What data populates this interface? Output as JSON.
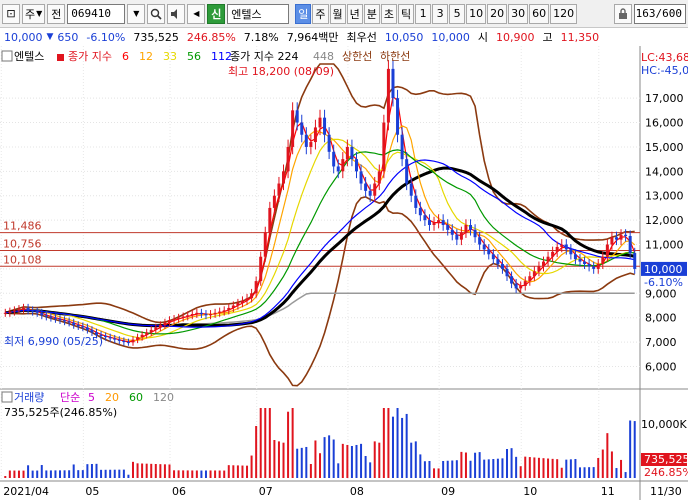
{
  "toolbar": {
    "icon_label": "⊡",
    "type_label": "주",
    "prev_label": "전",
    "code": "069410",
    "company_prefix": "신",
    "company": "엔텔스",
    "periods": [
      "일",
      "주",
      "월",
      "년",
      "분",
      "초",
      "틱",
      "1",
      "3",
      "5",
      "10",
      "20",
      "30",
      "60",
      "120"
    ],
    "active_period": "일",
    "page_counter": "163/600"
  },
  "quote": {
    "price": "10,000",
    "change": "650",
    "change_pct": "-6.10%",
    "volume": "735,525",
    "volume_pct": "246.85%",
    "turnover_pct": "7.18%",
    "amount": "7,964백만",
    "best_label": "최우선",
    "best_ask": "10,050",
    "best_bid": "10,000",
    "open_label": "시",
    "open": "10,900",
    "high_label": "고",
    "high": "11,350"
  },
  "chart_data": {
    "type": "candlestick",
    "legend": {
      "name": "엔텔스",
      "ma_label": "종가 지수",
      "ma_periods": [
        "6",
        "12",
        "33",
        "56",
        "112"
      ],
      "ma_colors": [
        "#ff0000",
        "#ffa500",
        "#e6d800",
        "#009900",
        "#0000ff"
      ],
      "ma_long_label": "종가 지수 224",
      "ma_long2": "448",
      "upper_band": "상한선",
      "lower_band": "하한선"
    },
    "annotations": {
      "high": "최고 18,200 (08/09)",
      "low": "최저 6,990 (05/25)"
    },
    "right_labels": {
      "lc": "LC:43,68",
      "hc": "HC:-45,0",
      "current": "10,000",
      "current_pct": "-6.10%"
    },
    "price_levels": [
      {
        "label": "11,486",
        "value": 11486
      },
      {
        "label": "10,756",
        "value": 10756
      },
      {
        "label": "10,108",
        "value": 10108
      }
    ],
    "y_ticks": [
      "17,000",
      "16,000",
      "15,000",
      "14,000",
      "13,000",
      "12,000",
      "11,000",
      "10,000",
      "9,000",
      "8,000",
      "7,000",
      "6,000"
    ],
    "y_tick_values": [
      17000,
      16000,
      15000,
      14000,
      13000,
      12000,
      11000,
      10000,
      9000,
      8000,
      7000,
      6000
    ],
    "y_range": [
      5200,
      18400
    ],
    "x_ticks": [
      "2021/04",
      "05",
      "06",
      "07",
      "08",
      "09",
      "10",
      "11",
      "11/30"
    ],
    "volume": {
      "label": "거래량",
      "ma_label": "단순",
      "ma_periods": [
        "5",
        "20",
        "60",
        "120"
      ],
      "ma_colors": [
        "#cc00cc",
        "#ff9900",
        "#009900",
        "#888888"
      ],
      "value_label": "735,525주(246.85%)",
      "y_tick": "10,000K",
      "current": "735,525",
      "current_pct": "246.85%"
    },
    "closes": [
      8200,
      8250,
      8300,
      8350,
      8400,
      8300,
      8250,
      8200,
      8100,
      8050,
      8000,
      7950,
      7900,
      7850,
      7800,
      7700,
      7650,
      7600,
      7500,
      7400,
      7300,
      7250,
      7200,
      7150,
      7100,
      7050,
      7000,
      6990,
      7100,
      7200,
      7300,
      7400,
      7500,
      7600,
      7700,
      7800,
      7900,
      7950,
      8000,
      8050,
      8100,
      8150,
      8200,
      8150,
      8100,
      8150,
      8200,
      8250,
      8300,
      8400,
      8500,
      8600,
      8700,
      8800,
      9000,
      9500,
      10500,
      11500,
      12500,
      13000,
      13500,
      14000,
      15000,
      16500,
      16000,
      15500,
      15000,
      15200,
      15800,
      16200,
      15500,
      14800,
      14200,
      14000,
      14500,
      15000,
      14500,
      14000,
      13500,
      13200,
      13000,
      13500,
      14000,
      16000,
      18200,
      17000,
      15500,
      14500,
      13500,
      13000,
      12500,
      12200,
      12000,
      11800,
      11900,
      12000,
      11800,
      11600,
      11400,
      11200,
      11500,
      11800,
      11600,
      11300,
      11000,
      10800,
      10600,
      10400,
      10200,
      10000,
      9700,
      9400,
      9200,
      9300,
      9500,
      9700,
      9900,
      10100,
      10300,
      10500,
      10700,
      10900,
      11000,
      10800,
      10600,
      10400,
      10300,
      10200,
      10100,
      10000,
      10200,
      10500,
      11000,
      11300,
      11200,
      11400,
      11350,
      10650,
      10000
    ]
  }
}
